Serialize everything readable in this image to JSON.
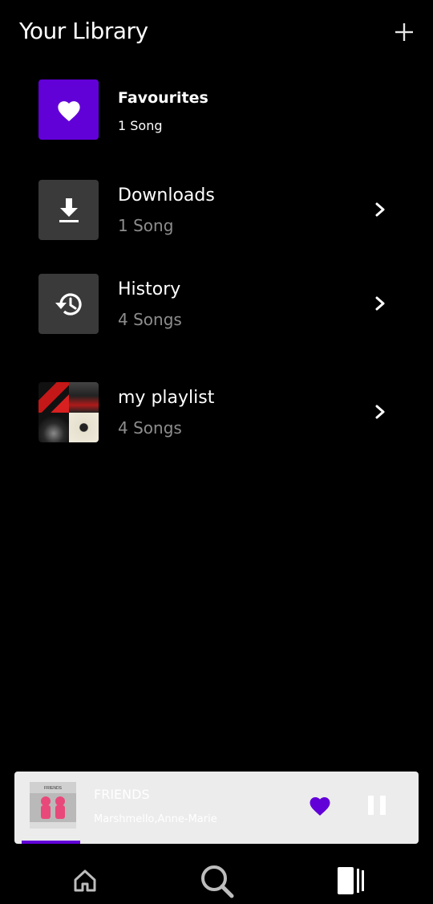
{
  "header": {
    "title": "Your Library",
    "add_icon": "plus-icon"
  },
  "library": {
    "items": [
      {
        "name": "Favourites",
        "count": "1 Song",
        "icon": "heart-icon",
        "color": "#6200d8"
      },
      {
        "name": "Downloads",
        "count": "1 Song",
        "icon": "download-icon",
        "color": "#3a3a3a"
      },
      {
        "name": "History",
        "count": "4 Songs",
        "icon": "history-icon",
        "color": "#3a3a3a"
      },
      {
        "name": "my playlist",
        "count": "4 Songs",
        "icon": "playlist-collage"
      }
    ]
  },
  "mini_player": {
    "title": "FRIENDS",
    "artist": "Marshmello,Anne-Marie",
    "album_cover_text": "FRIENDS",
    "progress": 0.15,
    "heart_color": "#6200d8"
  },
  "bottom_nav": {
    "items": [
      {
        "icon": "home-icon"
      },
      {
        "icon": "search-icon"
      },
      {
        "icon": "library-icon",
        "active": true
      }
    ]
  },
  "colors": {
    "accent": "#6200d8",
    "background": "#000000",
    "muted": "#8d8d8d"
  }
}
